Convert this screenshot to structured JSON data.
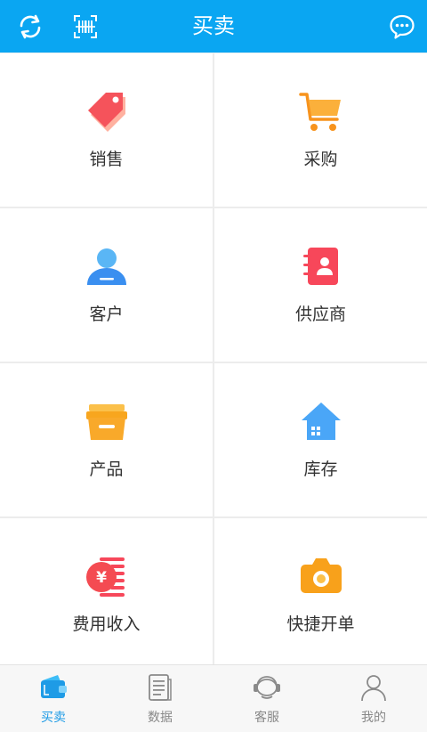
{
  "header": {
    "title": "买卖",
    "icons": [
      "refresh-icon",
      "barcode-scan-icon",
      "chat-icon"
    ],
    "background": "#0aa6f2"
  },
  "tiles": [
    {
      "label": "销售",
      "icon": "sales-tag-icon"
    },
    {
      "label": "采购",
      "icon": "shopping-cart-icon"
    },
    {
      "label": "客户",
      "icon": "customer-icon"
    },
    {
      "label": "供应商",
      "icon": "supplier-contact-book-icon"
    },
    {
      "label": "产品",
      "icon": "product-box-icon"
    },
    {
      "label": "库存",
      "icon": "warehouse-house-icon"
    },
    {
      "label": "费用收入",
      "icon": "expense-income-coin-icon"
    },
    {
      "label": "快捷开单",
      "icon": "quick-order-camera-icon"
    }
  ],
  "tabs": [
    {
      "label": "买卖",
      "icon": "wallet-icon",
      "active": true
    },
    {
      "label": "数据",
      "icon": "document-icon",
      "active": false
    },
    {
      "label": "客服",
      "icon": "headset-icon",
      "active": false
    },
    {
      "label": "我的",
      "icon": "profile-icon",
      "active": false
    }
  ],
  "colors": {
    "accent": "#0aa6f2",
    "active_tab": "#1e9be6",
    "inactive_tab": "#888888"
  }
}
